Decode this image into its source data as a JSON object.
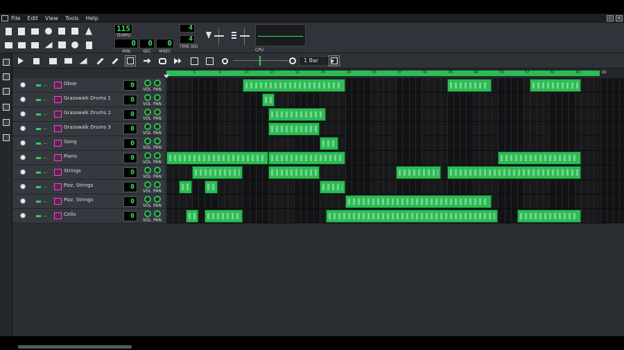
{
  "menu": {
    "items": [
      "File",
      "Edit",
      "View",
      "Tools",
      "Help"
    ]
  },
  "toolbar": {
    "tempo_value": "115",
    "tempo_label": "TEMPO",
    "min_value": "0",
    "min_label": "MIN",
    "sec_value": "0",
    "sec_label": "SEC",
    "msec_value": "0",
    "msec_label": "MSEC",
    "timesig_num": "4",
    "timesig_den": "4",
    "timesig_label": "TIME SIG",
    "cpu_label": "CPU"
  },
  "song_toolbar": {
    "zoom": "1 Bar"
  },
  "timeline": {
    "ticks": [
      "5",
      "9",
      "13",
      "17",
      "21",
      "25",
      "29",
      "33",
      "37",
      "41",
      "45",
      "49",
      "53",
      "57",
      "61",
      "65"
    ],
    "end_label": "69"
  },
  "tracks": [
    {
      "name": "Oboe",
      "value": "0"
    },
    {
      "name": "Grasswalk Drums 1",
      "value": "0"
    },
    {
      "name": "Grasswalk Drums 2",
      "value": "0"
    },
    {
      "name": "Grasswalk Drums 3",
      "value": "0"
    },
    {
      "name": "Gong",
      "value": "0"
    },
    {
      "name": "Piano",
      "value": "0"
    },
    {
      "name": "Strings",
      "value": "0"
    },
    {
      "name": "Pizz. Strings",
      "value": "0"
    },
    {
      "name": "Pizz. Strings",
      "value": "0"
    },
    {
      "name": "Cello",
      "value": "0"
    }
  ],
  "knob_labels": {
    "vol": "VOL",
    "pan": "PAN"
  },
  "clips": [
    {
      "track": 0,
      "start": 13,
      "end": 29
    },
    {
      "track": 0,
      "start": 45,
      "end": 52
    },
    {
      "track": 0,
      "start": 58,
      "end": 66
    },
    {
      "track": 1,
      "start": 16,
      "end": 18
    },
    {
      "track": 2,
      "start": 17,
      "end": 26
    },
    {
      "track": 3,
      "start": 17,
      "end": 25
    },
    {
      "track": 4,
      "start": 25,
      "end": 28
    },
    {
      "track": 5,
      "start": 1,
      "end": 17
    },
    {
      "track": 5,
      "start": 17,
      "end": 29
    },
    {
      "track": 5,
      "start": 53,
      "end": 66
    },
    {
      "track": 6,
      "start": 5,
      "end": 13
    },
    {
      "track": 6,
      "start": 17,
      "end": 25
    },
    {
      "track": 6,
      "start": 37,
      "end": 44
    },
    {
      "track": 6,
      "start": 45,
      "end": 66
    },
    {
      "track": 7,
      "start": 3,
      "end": 5
    },
    {
      "track": 7,
      "start": 7,
      "end": 9
    },
    {
      "track": 7,
      "start": 25,
      "end": 29
    },
    {
      "track": 8,
      "start": 29,
      "end": 52
    },
    {
      "track": 9,
      "start": 4,
      "end": 6
    },
    {
      "track": 9,
      "start": 7,
      "end": 13
    },
    {
      "track": 9,
      "start": 26,
      "end": 53
    },
    {
      "track": 9,
      "start": 56,
      "end": 66
    }
  ],
  "icons": {
    "toolbar": [
      "new-file-icon",
      "new-from-template-icon",
      "open-file-icon",
      "open-recent-icon",
      "save-icon",
      "save-as-icon",
      "export-icon",
      "metronome-icon"
    ],
    "windows": [
      "song-editor-icon",
      "beat-editor-icon",
      "piano-roll-icon",
      "automation-editor-icon",
      "mixer-icon",
      "controller-rack-icon",
      "project-notes-icon"
    ],
    "sidebar": [
      "instrument-plugins-icon",
      "my-projects-icon",
      "my-samples-icon",
      "my-presets-icon",
      "home-icon",
      "root-directory-icon"
    ]
  }
}
